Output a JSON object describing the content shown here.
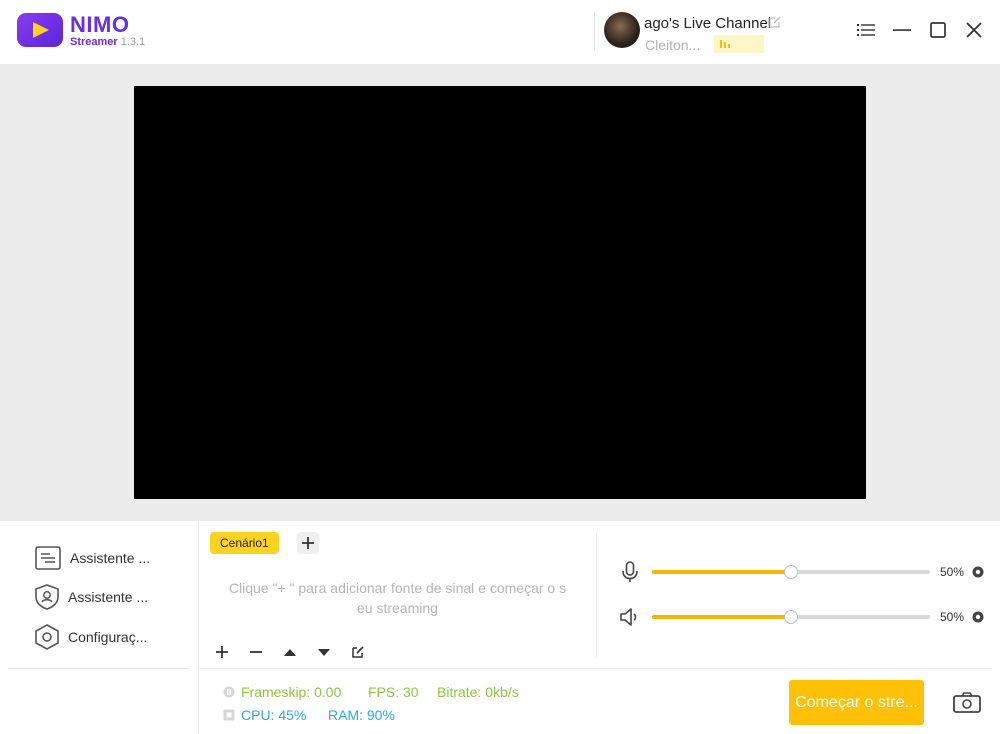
{
  "app": {
    "brand": "NIMO",
    "subtitle": "Streamer",
    "version": "1.3.1"
  },
  "account": {
    "channel_name": "ago's Live Channel",
    "user_name": "Cleiton...",
    "icons": [
      "avatar",
      "edit-icon",
      "level-badge-icon"
    ]
  },
  "window_controls": [
    "menu-icon",
    "minimize-icon",
    "maximize-icon",
    "close-icon"
  ],
  "sidebar": {
    "items": [
      {
        "label": "Assistente ...",
        "icon": "assistant-list-icon"
      },
      {
        "label": "Assistente ...",
        "icon": "assistant-shield-icon"
      },
      {
        "label": "Configuraç...",
        "icon": "settings-hex-icon"
      }
    ]
  },
  "scenes": {
    "tabs": [
      {
        "label": "Cenário1",
        "active": true
      }
    ],
    "add_label": "+",
    "hint_line1": "Clique \"+ \" para adicionar fonte de sinal e começar o s",
    "hint_line2": "eu streaming",
    "toolbar": [
      "add-source-icon",
      "remove-source-icon",
      "move-up-icon",
      "move-down-icon",
      "edit-source-icon"
    ]
  },
  "audio": {
    "microphone": {
      "level": 50,
      "label": "50%"
    },
    "speaker": {
      "level": 50,
      "label": "50%"
    }
  },
  "stats": {
    "frameskip_label": "Frameskip:",
    "frameskip_value": "0.00",
    "fps_label": "FPS:",
    "fps_value": "30",
    "bitrate_label": "Bitrate:",
    "bitrate_value": "0kb/s",
    "cpu_label": "CPU:",
    "cpu_value": "45%",
    "ram_label": "RAM:",
    "ram_value": "90%"
  },
  "actions": {
    "start_label": "Começar o stre..."
  },
  "colors": {
    "brand": "#6a2ee6",
    "accent": "#ffc107",
    "slider": "#f5b800",
    "stat_green": "#8cc63f",
    "stat_blue": "#2ea7e0"
  }
}
